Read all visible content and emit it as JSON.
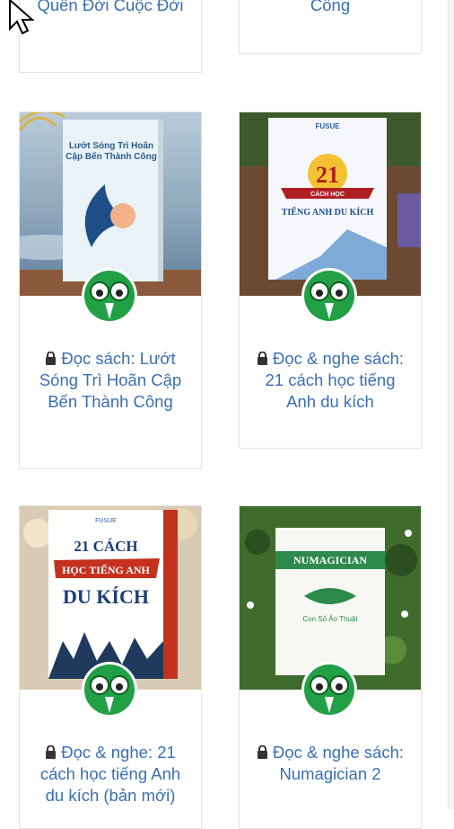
{
  "cards": [
    {
      "title": "Quên Đời Cuộc Đời"
    },
    {
      "title": "Công"
    },
    {
      "title": "Đọc sách: Lướt Sóng Trì Hoãn Cập Bến Thành Công",
      "cover_text": [
        "Lướt Sóng Trì Hoãn",
        "Cập Bến Thành Công"
      ]
    },
    {
      "title": "Đọc & nghe sách: 21 cách học tiếng Anh du kích",
      "cover_text": [
        "FUSUE",
        "21",
        "CÁCH HỌC",
        "TIẾNG ANH DU KÍCH"
      ]
    },
    {
      "title": "Đọc & nghe: 21 cách học tiếng Anh du kích (bản mới)",
      "cover_text": [
        "FUSUE",
        "21 CÁCH",
        "HỌC TIẾNG ANH",
        "DU KÍCH"
      ]
    },
    {
      "title": "Đọc & nghe sách: Numagician 2",
      "cover_text": [
        "NUMAGICIAN",
        "Con Số Ảo Thuật"
      ]
    }
  ],
  "colors": {
    "link": "#3a6fb5",
    "badge_green": "#22a046",
    "border": "#e3e3e3"
  },
  "icons": [
    "lock-icon",
    "owl-badge-icon",
    "cursor-arrow-icon"
  ]
}
